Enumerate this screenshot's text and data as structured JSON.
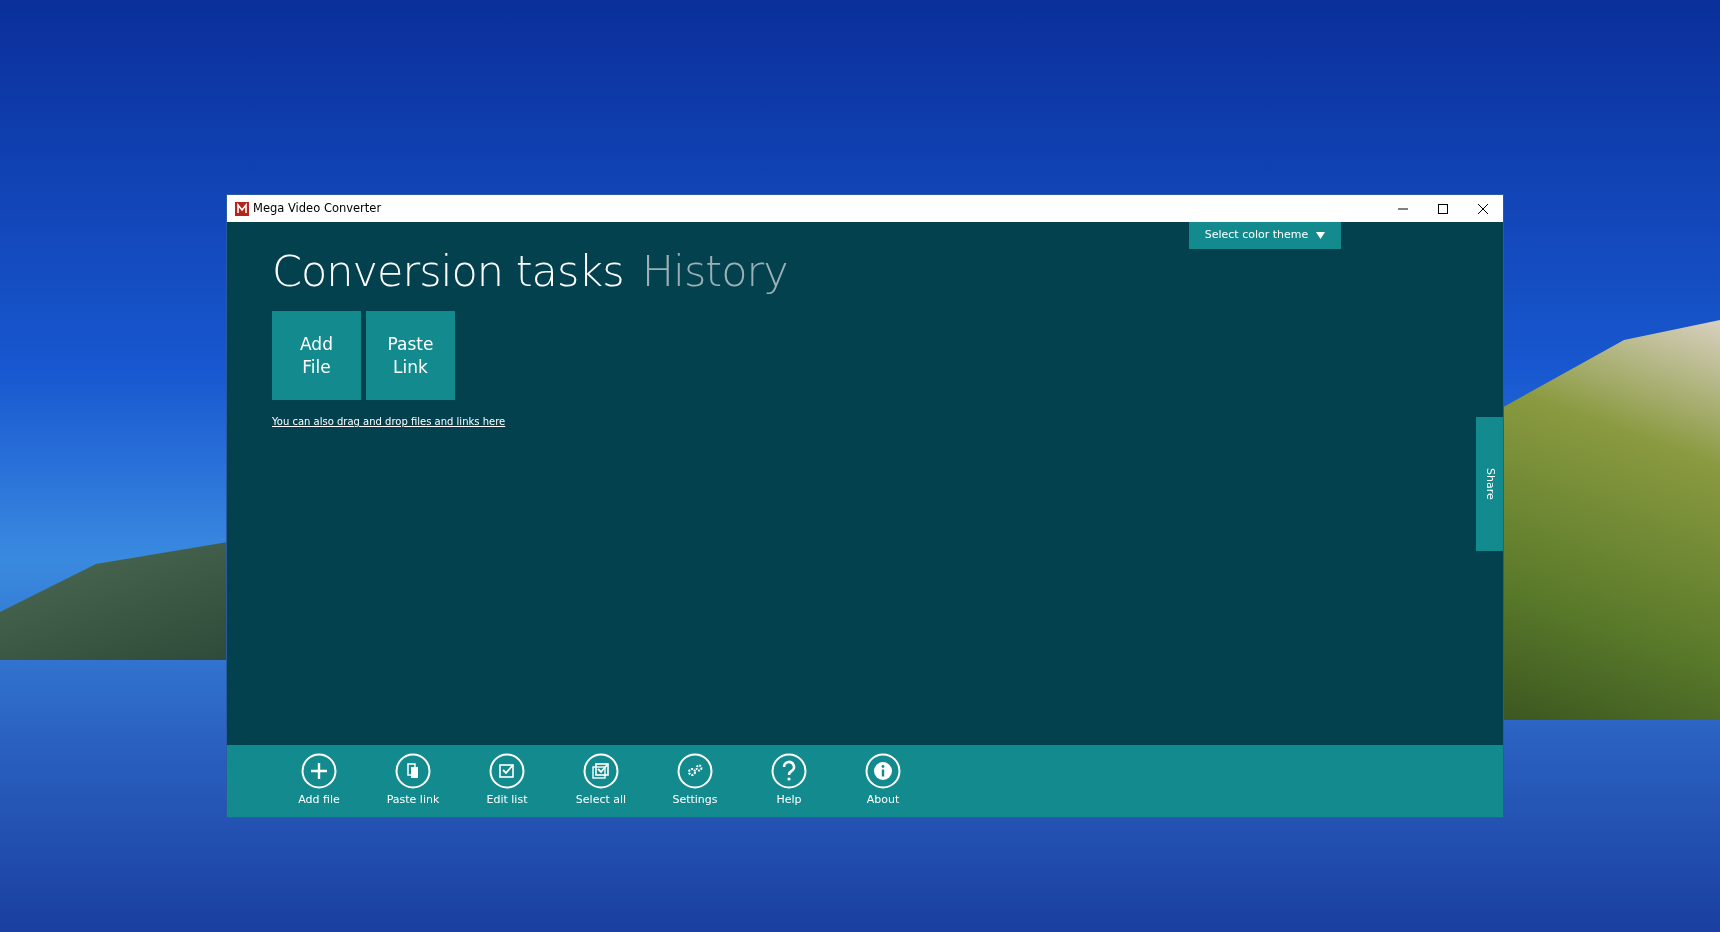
{
  "window": {
    "title": "Mega Video Converter"
  },
  "theme_button": {
    "label": "Select color theme"
  },
  "tabs": [
    {
      "label": "Conversion tasks",
      "selected": true
    },
    {
      "label": "History",
      "selected": false
    }
  ],
  "tiles": [
    {
      "lines": [
        "Add",
        "File"
      ]
    },
    {
      "lines": [
        "Paste",
        "Link"
      ]
    }
  ],
  "hint_link": "You can also drag and drop files and links here",
  "share_tab": {
    "label": "Share"
  },
  "toolbar": [
    {
      "label": "Add file"
    },
    {
      "label": "Paste link"
    },
    {
      "label": "Edit list"
    },
    {
      "label": "Select all"
    },
    {
      "label": "Settings"
    },
    {
      "label": "Help"
    },
    {
      "label": "About"
    }
  ]
}
